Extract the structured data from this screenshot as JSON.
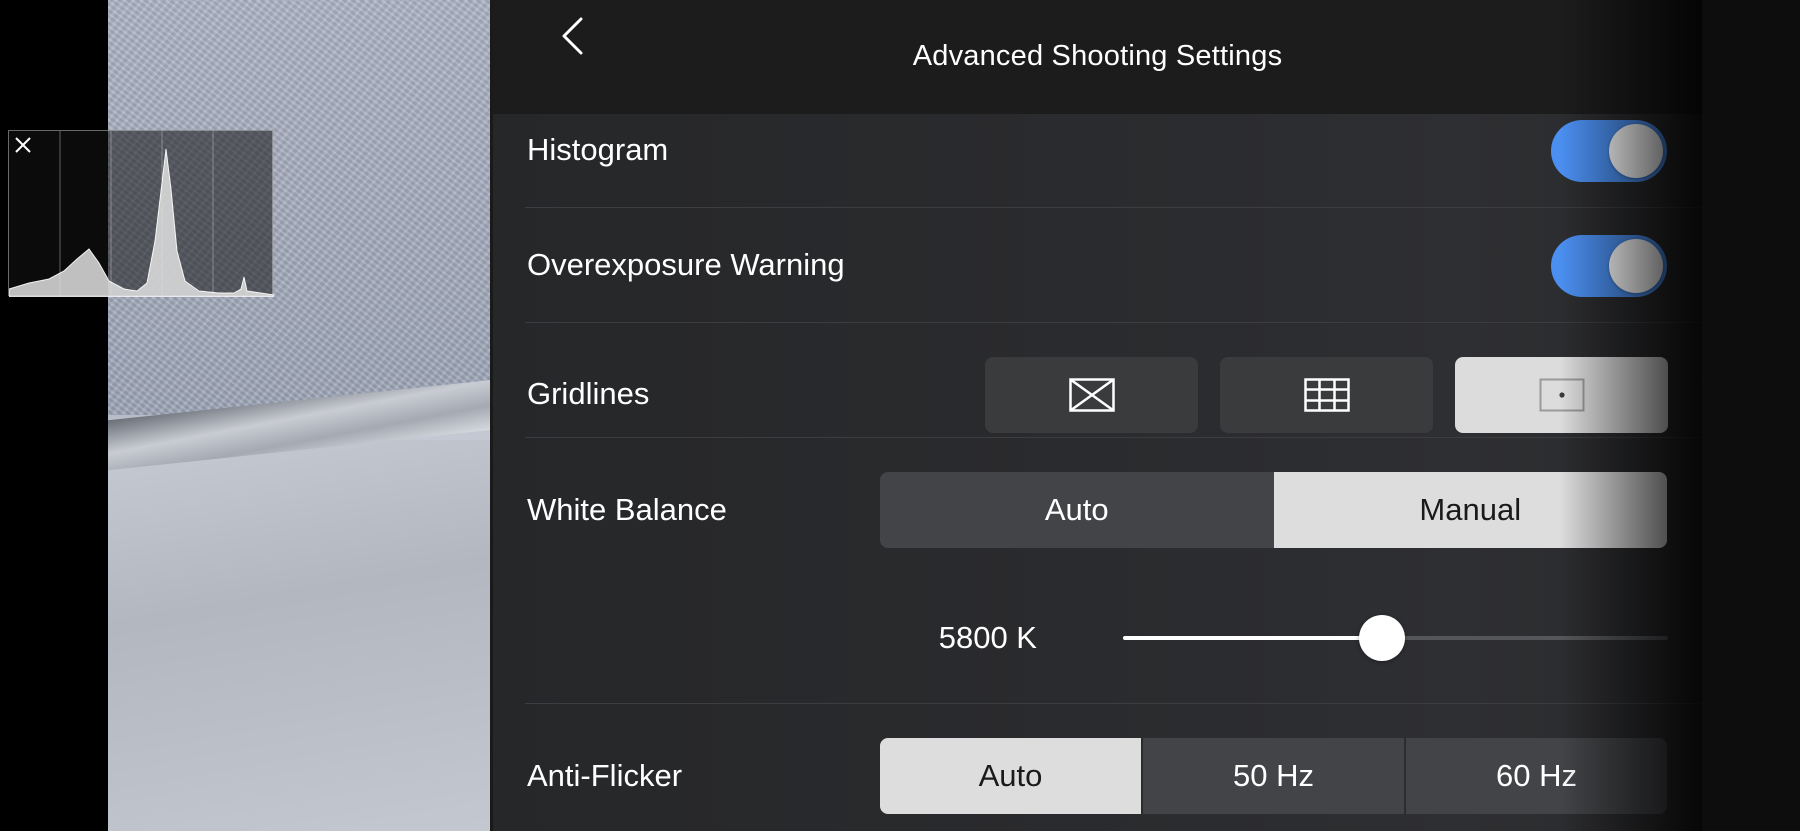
{
  "header": {
    "title": "Advanced Shooting Settings",
    "back_icon": "chevron-left-icon"
  },
  "histogram_overlay": {
    "close_icon": "close-icon"
  },
  "settings": {
    "histogram": {
      "label": "Histogram",
      "enabled": true
    },
    "overexposure_warning": {
      "label": "Overexposure Warning",
      "enabled": true
    },
    "gridlines": {
      "label": "Gridlines",
      "options": [
        {
          "icon": "grid-diagonals-icon",
          "selected": false
        },
        {
          "icon": "grid-thirds-icon",
          "selected": false
        },
        {
          "icon": "grid-center-point-icon",
          "selected": true
        }
      ]
    },
    "white_balance": {
      "label": "White Balance",
      "options": [
        "Auto",
        "Manual"
      ],
      "selected": "Manual",
      "kelvin_label": "5800 K",
      "slider_fraction": 0.475
    },
    "anti_flicker": {
      "label": "Anti-Flicker",
      "options": [
        "Auto",
        "50 Hz",
        "60 Hz"
      ],
      "selected": "Auto"
    }
  },
  "colors": {
    "toggle_on": "#4b8ff0",
    "selected_segment": "#dddddd",
    "panel_bg": "#2b2c2f"
  }
}
